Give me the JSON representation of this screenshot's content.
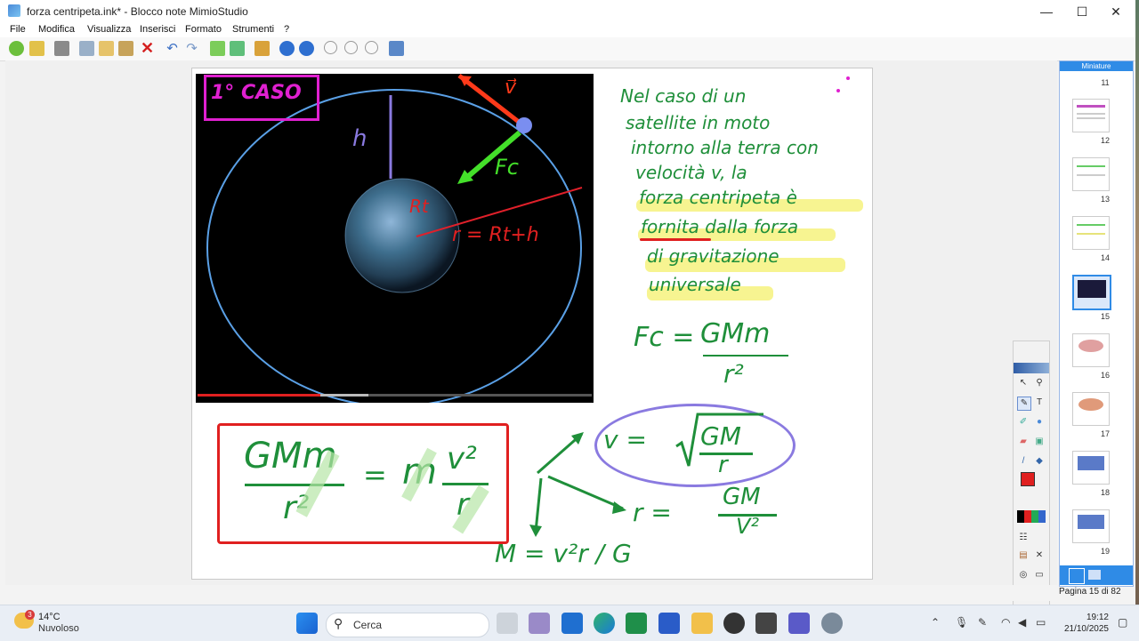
{
  "window": {
    "title": "forza centripeta.ink* - Blocco note MimioStudio",
    "minimize": "—",
    "maximize": "☐",
    "close": "✕"
  },
  "menu": [
    "File",
    "Modifica",
    "Visualizza",
    "Inserisci",
    "Formato",
    "Strumenti",
    "?"
  ],
  "toolbar_icons": [
    "page-forward-icon",
    "save-icon",
    "print-icon",
    "cut-icon",
    "copy-icon",
    "paste-icon",
    "delete-icon",
    "undo-icon",
    "redo-icon",
    "add-page-icon",
    "insert-page-icon",
    "gallery-icon",
    "back-icon",
    "forward-icon",
    "zoom-in-icon",
    "zoom-out-icon",
    "zoom-fit-icon",
    "screen-icon"
  ],
  "slide": {
    "case_label": "1° CASO",
    "photo_labels": {
      "v": "v⃗",
      "h": "h",
      "fc": "Fc",
      "rt": "Rt",
      "r_eq": "r = Rt+h"
    },
    "notes_lines": [
      "Nel caso di un",
      "satellite in moto",
      "intorno alla terra con",
      "velocità v, la",
      "forza centripeta è",
      "fornita dalla forza",
      "di gravitazione",
      "universale"
    ],
    "fc_formula": {
      "lhs": "Fc = ",
      "num": "GMm",
      "den": "r²"
    },
    "boxed": {
      "num1": "GMm",
      "den1": "r²",
      "eq": "=",
      "m": "m",
      "num2": "v²",
      "den2": "r"
    },
    "v_formula": {
      "lhs": "v = ",
      "num": "GM",
      "den": "r"
    },
    "r_formula": {
      "lhs": "r = ",
      "num": "GM",
      "den": "V²"
    },
    "m_formula": "M = v²r / G"
  },
  "side_panel": {
    "title": "Miniature",
    "thumbs": [
      "11",
      "12",
      "13",
      "14",
      "15",
      "16",
      "17",
      "18",
      "19"
    ],
    "selected": "15"
  },
  "tool_palette": [
    "select-icon",
    "zoom-icon",
    "pen-icon",
    "text-icon",
    "highlighter-icon",
    "shape-icon",
    "eraser-icon",
    "image-icon",
    "line-icon",
    "fill-icon",
    "color-icon",
    "grid-icon",
    "stamp-icon",
    "resize-icon",
    "clear-icon",
    "display-icon"
  ],
  "status": {
    "page": "Pagina 15 di 82"
  },
  "taskbar": {
    "weather_temp": "14°C",
    "weather_desc": "Nuvoloso",
    "weather_badge": "3",
    "search": "Cerca",
    "time": "19:12",
    "date": "21/10/2025"
  },
  "colors": {
    "accent": "#2f8be6",
    "ink_green": "#1f8f3a",
    "ink_red": "#e02020",
    "ink_magenta": "#e020d0",
    "ink_purple": "#8a7ae0"
  }
}
